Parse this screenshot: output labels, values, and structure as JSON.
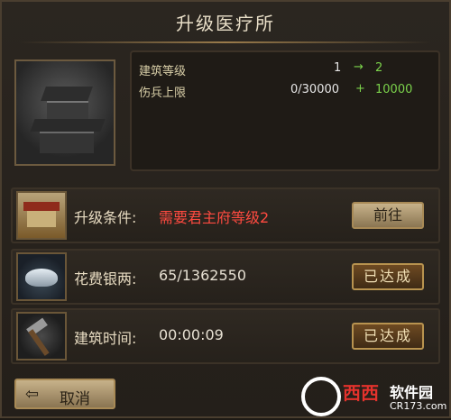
{
  "title": "升级医疗所",
  "stats": {
    "building_level": {
      "label": "建筑等级",
      "current": "1",
      "arrow": "→",
      "next": "2"
    },
    "wounded_cap": {
      "label": "伤兵上限",
      "current": "0/30000",
      "plus": "+",
      "add": "10000"
    }
  },
  "rows": [
    {
      "label": "升级条件:",
      "value": "需要君主府等级2",
      "button": "前往",
      "icon": "palace-icon"
    },
    {
      "label": "花费银两:",
      "value": "65/1362550",
      "button": "已达成",
      "icon": "silver-ingot-icon"
    },
    {
      "label": "建筑时间:",
      "value": "00:00:09",
      "button": "已达成",
      "icon": "hammer-icon"
    }
  ],
  "cancel_button": {
    "icon": "back-arrow-icon",
    "label": "取消"
  },
  "watermark": {
    "brand": "西西",
    "site": "软件园",
    "url": "CR173.com"
  },
  "colors": {
    "requirement_red": "#ff4a40",
    "increase_green": "#7bd24b"
  }
}
